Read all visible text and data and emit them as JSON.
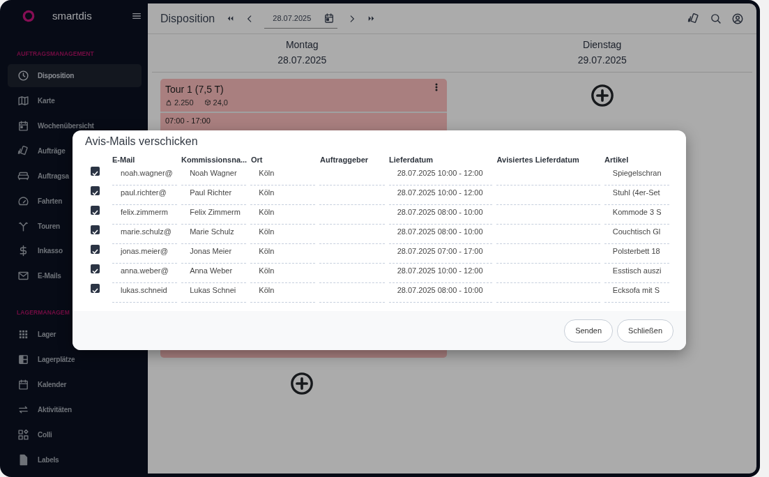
{
  "sidebar": {
    "brand": "smartdis",
    "sections": [
      {
        "title": "AUFTRAGSMANAGEMENT",
        "items": [
          {
            "label": "Disposition",
            "selected": true
          },
          {
            "label": "Karte",
            "selected": false
          },
          {
            "label": "Wochenübersicht",
            "selected": false
          },
          {
            "label": "Aufträge",
            "selected": false
          },
          {
            "label": "Auftragsa",
            "selected": false
          },
          {
            "label": "Fahrten",
            "selected": false
          },
          {
            "label": "Touren",
            "selected": false
          },
          {
            "label": "Inkasso",
            "selected": false
          },
          {
            "label": "E-Mails",
            "selected": false
          }
        ]
      },
      {
        "title": "LAGERMANAGEM",
        "items": [
          {
            "label": "Lager",
            "selected": false
          },
          {
            "label": "Lagerplätze",
            "selected": false
          },
          {
            "label": "Kalender",
            "selected": false
          },
          {
            "label": "Aktivitäten",
            "selected": false
          },
          {
            "label": "Colli",
            "selected": false
          },
          {
            "label": "Labels",
            "selected": false
          }
        ]
      }
    ]
  },
  "toolbar": {
    "title": "Disposition",
    "date": "28.07.2025"
  },
  "days": [
    {
      "weekday": "Montag",
      "date": "28.07.2025",
      "tours": [
        {
          "title": "Tour 1 (7,5 T)",
          "weight": "2.250",
          "volume": "24,0",
          "time": "07:00 - 17:00"
        }
      ]
    },
    {
      "weekday": "Dienstag",
      "date": "29.07.2025"
    }
  ],
  "modal": {
    "title": "Avis-Mails verschicken",
    "columns": [
      "E-Mail",
      "Kommissionsna...",
      "Ort",
      "Auftraggeber",
      "Lieferdatum",
      "Avisiertes Lieferdatum",
      "Artikel"
    ],
    "rows": [
      {
        "checked": true,
        "cells": [
          "noah.wagner@",
          "Noah Wagner",
          "Köln",
          "",
          "28.07.2025 10:00 - 12:00",
          "",
          "Spiegelschran"
        ]
      },
      {
        "checked": true,
        "cells": [
          "paul.richter@",
          "Paul Richter",
          "Köln",
          "",
          "28.07.2025 10:00 - 12:00",
          "",
          "Stuhl (4er-Set"
        ]
      },
      {
        "checked": true,
        "cells": [
          "felix.zimmerm",
          "Felix Zimmerm",
          "Köln",
          "",
          "28.07.2025 08:00 - 10:00",
          "",
          "Kommode 3 S"
        ]
      },
      {
        "checked": true,
        "cells": [
          "marie.schulz@",
          "Marie Schulz",
          "Köln",
          "",
          "28.07.2025 08:00 - 10:00",
          "",
          "Couchtisch Gl"
        ]
      },
      {
        "checked": true,
        "cells": [
          "jonas.meier@",
          "Jonas Meier",
          "Köln",
          "",
          "28.07.2025 07:00 - 17:00",
          "",
          "Polsterbett 18"
        ]
      },
      {
        "checked": true,
        "cells": [
          "anna.weber@",
          "Anna Weber",
          "Köln",
          "",
          "28.07.2025 10:00 - 12:00",
          "",
          "Esstisch auszi"
        ]
      },
      {
        "checked": true,
        "cells": [
          "lukas.schneid",
          "Lukas Schnei",
          "Köln",
          "",
          "28.07.2025 08:00 - 10:00",
          "",
          "Ecksofa mit S"
        ]
      }
    ],
    "buttons": [
      "Senden",
      "Schließen"
    ]
  }
}
